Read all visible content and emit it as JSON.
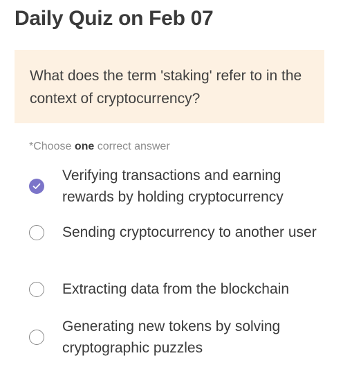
{
  "quiz": {
    "title": "Daily Quiz on Feb 07",
    "question": "What does the term 'staking' refer to in the context of cryptocurrency?",
    "instruction": {
      "prefix": "*Choose ",
      "emphasis": "one",
      "suffix": " correct answer"
    },
    "options": [
      {
        "label": "Verifying transactions and earning rewards by holding cryptocurrency",
        "selected": true
      },
      {
        "label": "Sending cryptocurrency to another user",
        "selected": false
      },
      {
        "label": "Extracting data from the blockchain",
        "selected": false
      },
      {
        "label": "Generating new tokens by solving cryptographic puzzles",
        "selected": false
      }
    ]
  },
  "colors": {
    "accent": "#7b74c9",
    "question_bg": "#fdf1e2",
    "muted_text": "#8d8d8d"
  },
  "icons": {
    "selected": "check-icon",
    "unselected": "radio-empty-icon"
  }
}
